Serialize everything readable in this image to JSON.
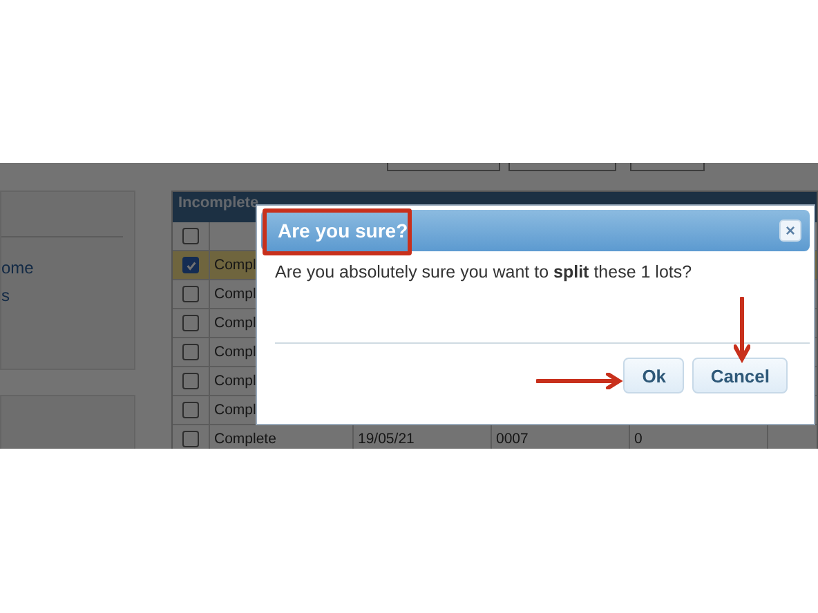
{
  "sidebar": {
    "items": [
      "ome",
      "s"
    ]
  },
  "table": {
    "title": "Incomplete",
    "header_checked": false,
    "rows": [
      {
        "checked": true,
        "selected": true,
        "cells": [
          "Compl"
        ]
      },
      {
        "checked": false,
        "selected": false,
        "cells": [
          "Compl"
        ]
      },
      {
        "checked": false,
        "selected": false,
        "cells": [
          "Compl"
        ]
      },
      {
        "checked": false,
        "selected": false,
        "cells": [
          "Compl"
        ]
      },
      {
        "checked": false,
        "selected": false,
        "cells": [
          "Compl"
        ]
      },
      {
        "checked": false,
        "selected": false,
        "cells": [
          "Compl"
        ]
      },
      {
        "checked": false,
        "selected": false,
        "cells": [
          "Complete",
          "19/05/21",
          "0007",
          "0"
        ]
      }
    ]
  },
  "dialog": {
    "title": "Are you sure?",
    "message": "Are you absolutely sure you want to **split** these 1 lots?",
    "close": "×",
    "buttons": [
      "Ok",
      "Cancel"
    ]
  }
}
